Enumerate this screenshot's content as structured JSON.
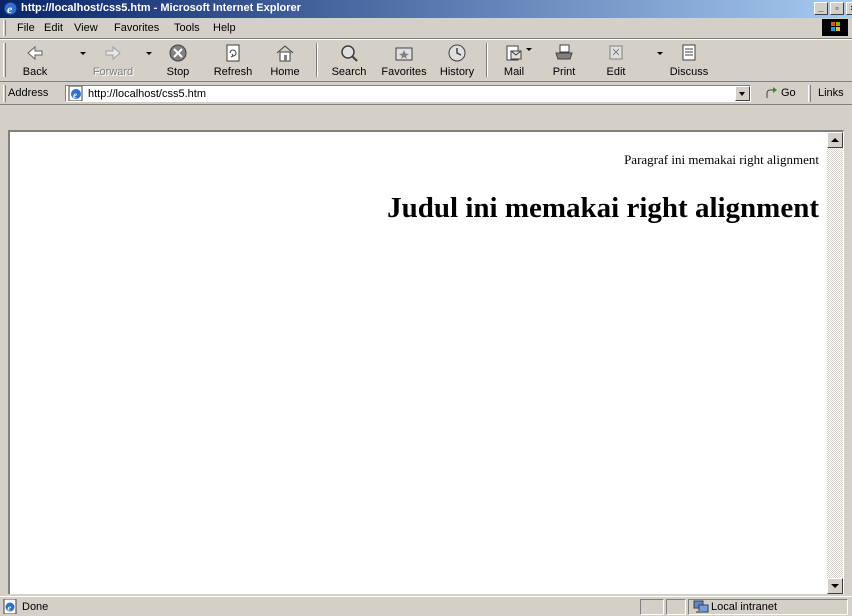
{
  "window": {
    "title": "http://localhost/css5.htm - Microsoft Internet Explorer",
    "controls": [
      "minimize",
      "maximize",
      "close"
    ]
  },
  "menu": {
    "items": [
      "File",
      "Edit",
      "View",
      "Favorites",
      "Tools",
      "Help"
    ]
  },
  "toolbar": {
    "buttons": [
      {
        "label": "Back",
        "icon": "back-arrow-icon",
        "enabled": true
      },
      {
        "label": "Forward",
        "icon": "forward-arrow-icon",
        "enabled": false
      },
      {
        "label": "Stop",
        "icon": "stop-icon",
        "enabled": true
      },
      {
        "label": "Refresh",
        "icon": "refresh-icon",
        "enabled": true
      },
      {
        "label": "Home",
        "icon": "home-icon",
        "enabled": true
      },
      {
        "label": "Search",
        "icon": "search-icon",
        "enabled": true
      },
      {
        "label": "Favorites",
        "icon": "favorites-icon",
        "enabled": true
      },
      {
        "label": "History",
        "icon": "history-icon",
        "enabled": true
      },
      {
        "label": "Mail",
        "icon": "mail-icon",
        "enabled": true
      },
      {
        "label": "Print",
        "icon": "print-icon",
        "enabled": true
      },
      {
        "label": "Edit",
        "icon": "edit-icon",
        "enabled": true
      },
      {
        "label": "Discuss",
        "icon": "discuss-icon",
        "enabled": true
      }
    ]
  },
  "address": {
    "label": "Address",
    "url": "http://localhost/css5.htm",
    "go_label": "Go",
    "links_label": "Links"
  },
  "page": {
    "paragraph": "Paragraf ini memakai right alignment",
    "heading": "Judul ini memakai right alignment"
  },
  "status": {
    "text": "Done",
    "zone": "Local intranet"
  },
  "colors": {
    "titlebar_start": "#0a246a",
    "titlebar_end": "#a6caf0",
    "chrome": "#d4d0c8",
    "page_background": "#ffffff"
  }
}
